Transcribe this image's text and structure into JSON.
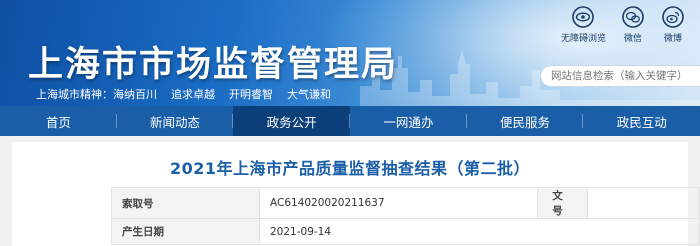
{
  "header": {
    "title": "上海市市场监督管理局",
    "spirit": [
      "上海城市精神：海纳百川",
      "追求卓越",
      "开明睿智",
      "大气谦和"
    ],
    "quick_links": [
      {
        "label": "无障碍浏览",
        "icon": "eye-icon"
      },
      {
        "label": "微信",
        "icon": "wechat-icon"
      },
      {
        "label": "微博",
        "icon": "weibo-icon"
      }
    ],
    "search_placeholder": "网站信息检索（输入关键字）"
  },
  "nav": {
    "items": [
      "首页",
      "新闻动态",
      "政务公开",
      "一网通办",
      "便民服务",
      "政民互动"
    ],
    "active_index": 2
  },
  "article": {
    "title": "2021年上海市产品质量监督抽查结果（第二批）",
    "meta": [
      {
        "label": "索取号",
        "value": "AC614020020211637",
        "label2": "文号",
        "value2": ""
      },
      {
        "label": "产生日期",
        "value": "2021-09-14"
      }
    ]
  },
  "colors": {
    "brand_blue": "#1b5ea8",
    "nav_active": "#0d3f7a",
    "title_blue": "#1a5fa8"
  }
}
